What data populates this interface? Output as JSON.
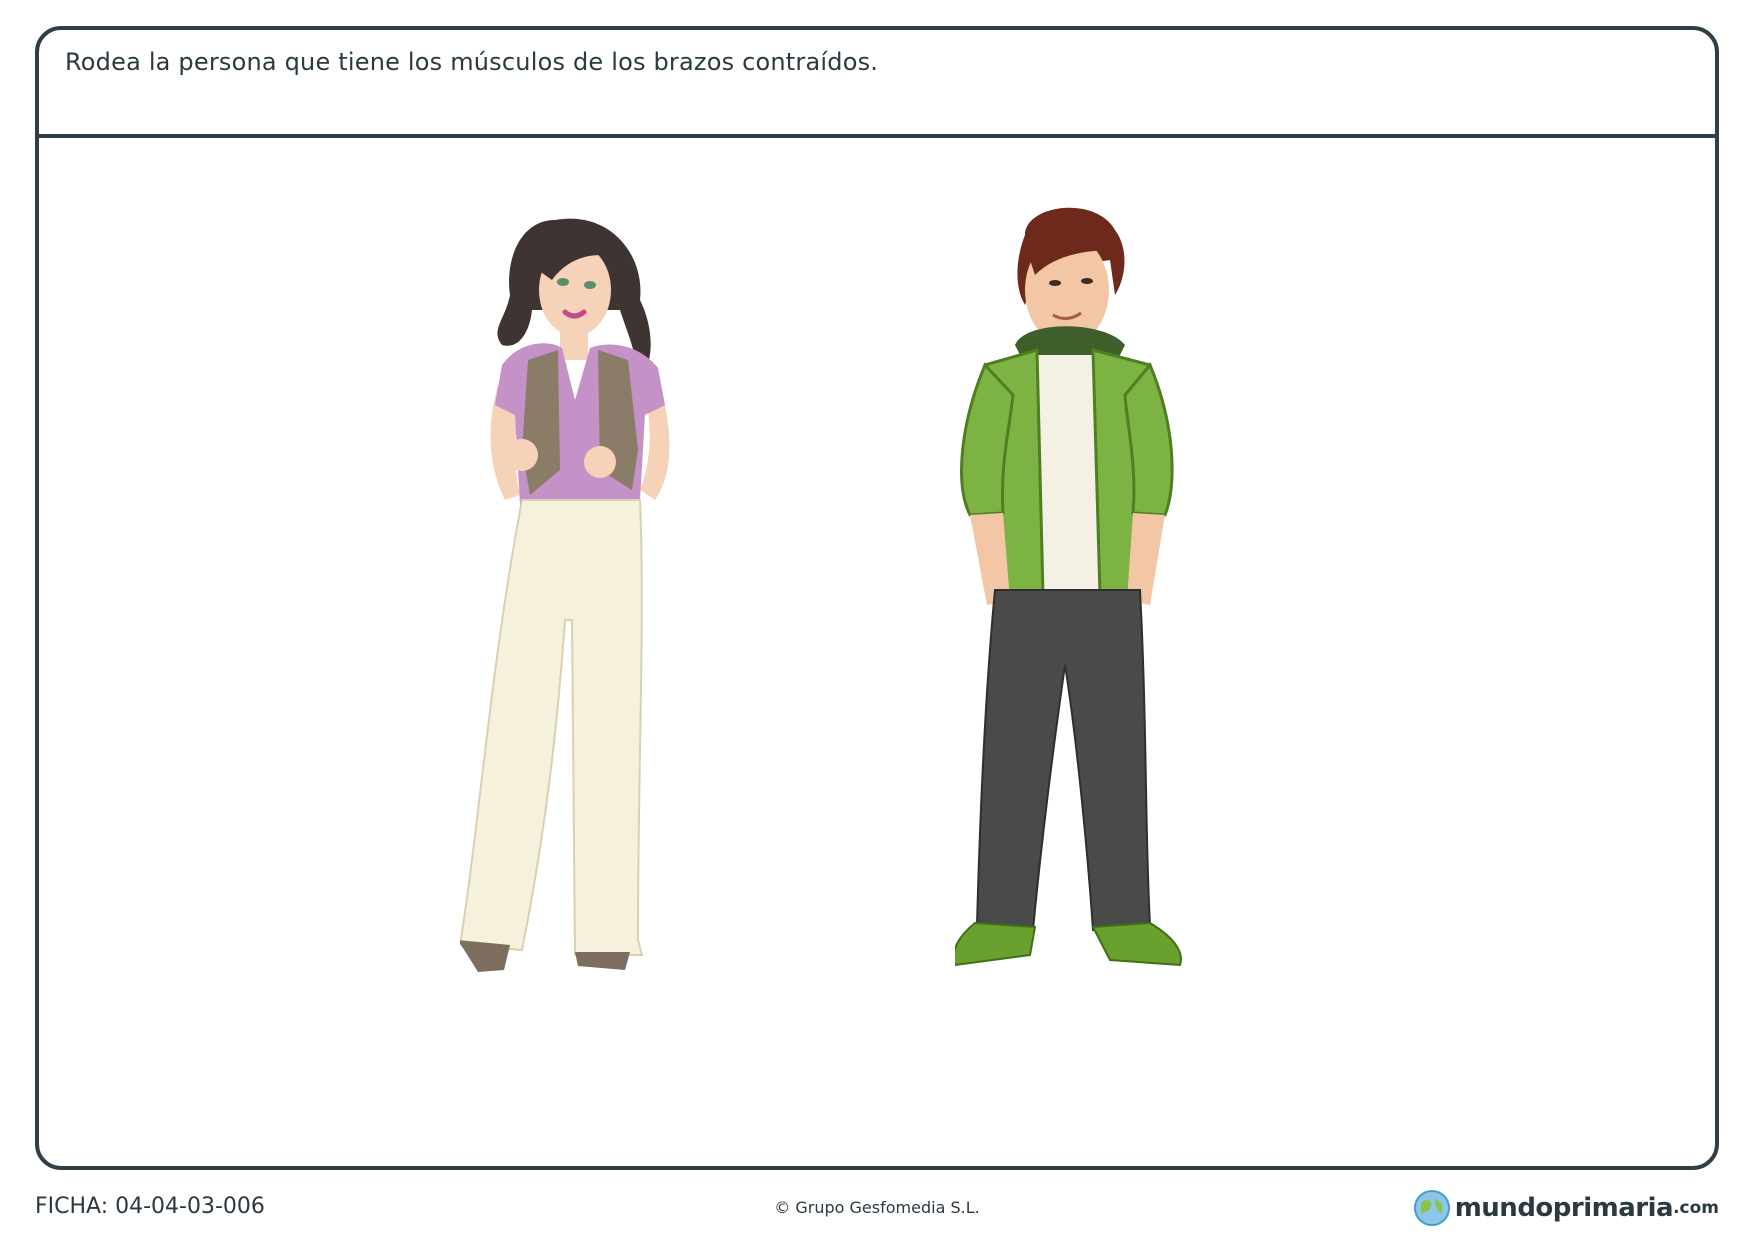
{
  "worksheet": {
    "instruction": "Rodea la persona que tiene los músculos de los brazos contraídos.",
    "figures": [
      {
        "name": "girl",
        "colors": {
          "top": "#c592c8",
          "vest": "#8a7c66",
          "pants": "#f6f1dc",
          "hair": "#3e3431",
          "skin": "#f6d2b8"
        }
      },
      {
        "name": "boy",
        "colors": {
          "jacket": "#7cb342",
          "shirt": "#f4f1e4",
          "pants": "#4a4a4a",
          "hair": "#6d2a1c",
          "shoes": "#6aa12e",
          "skin": "#f3c6a5"
        }
      }
    ]
  },
  "footer": {
    "code": "FICHA: 04-04-03-006",
    "copyright": "© Grupo Gesfomedia S.L.",
    "brand_name": "mundoprimaria",
    "brand_tld": ".com"
  },
  "colors": {
    "border": "#2f3f45",
    "text": "#2b3a40"
  },
  "icons": {
    "brand_logo": "globe-icon"
  }
}
